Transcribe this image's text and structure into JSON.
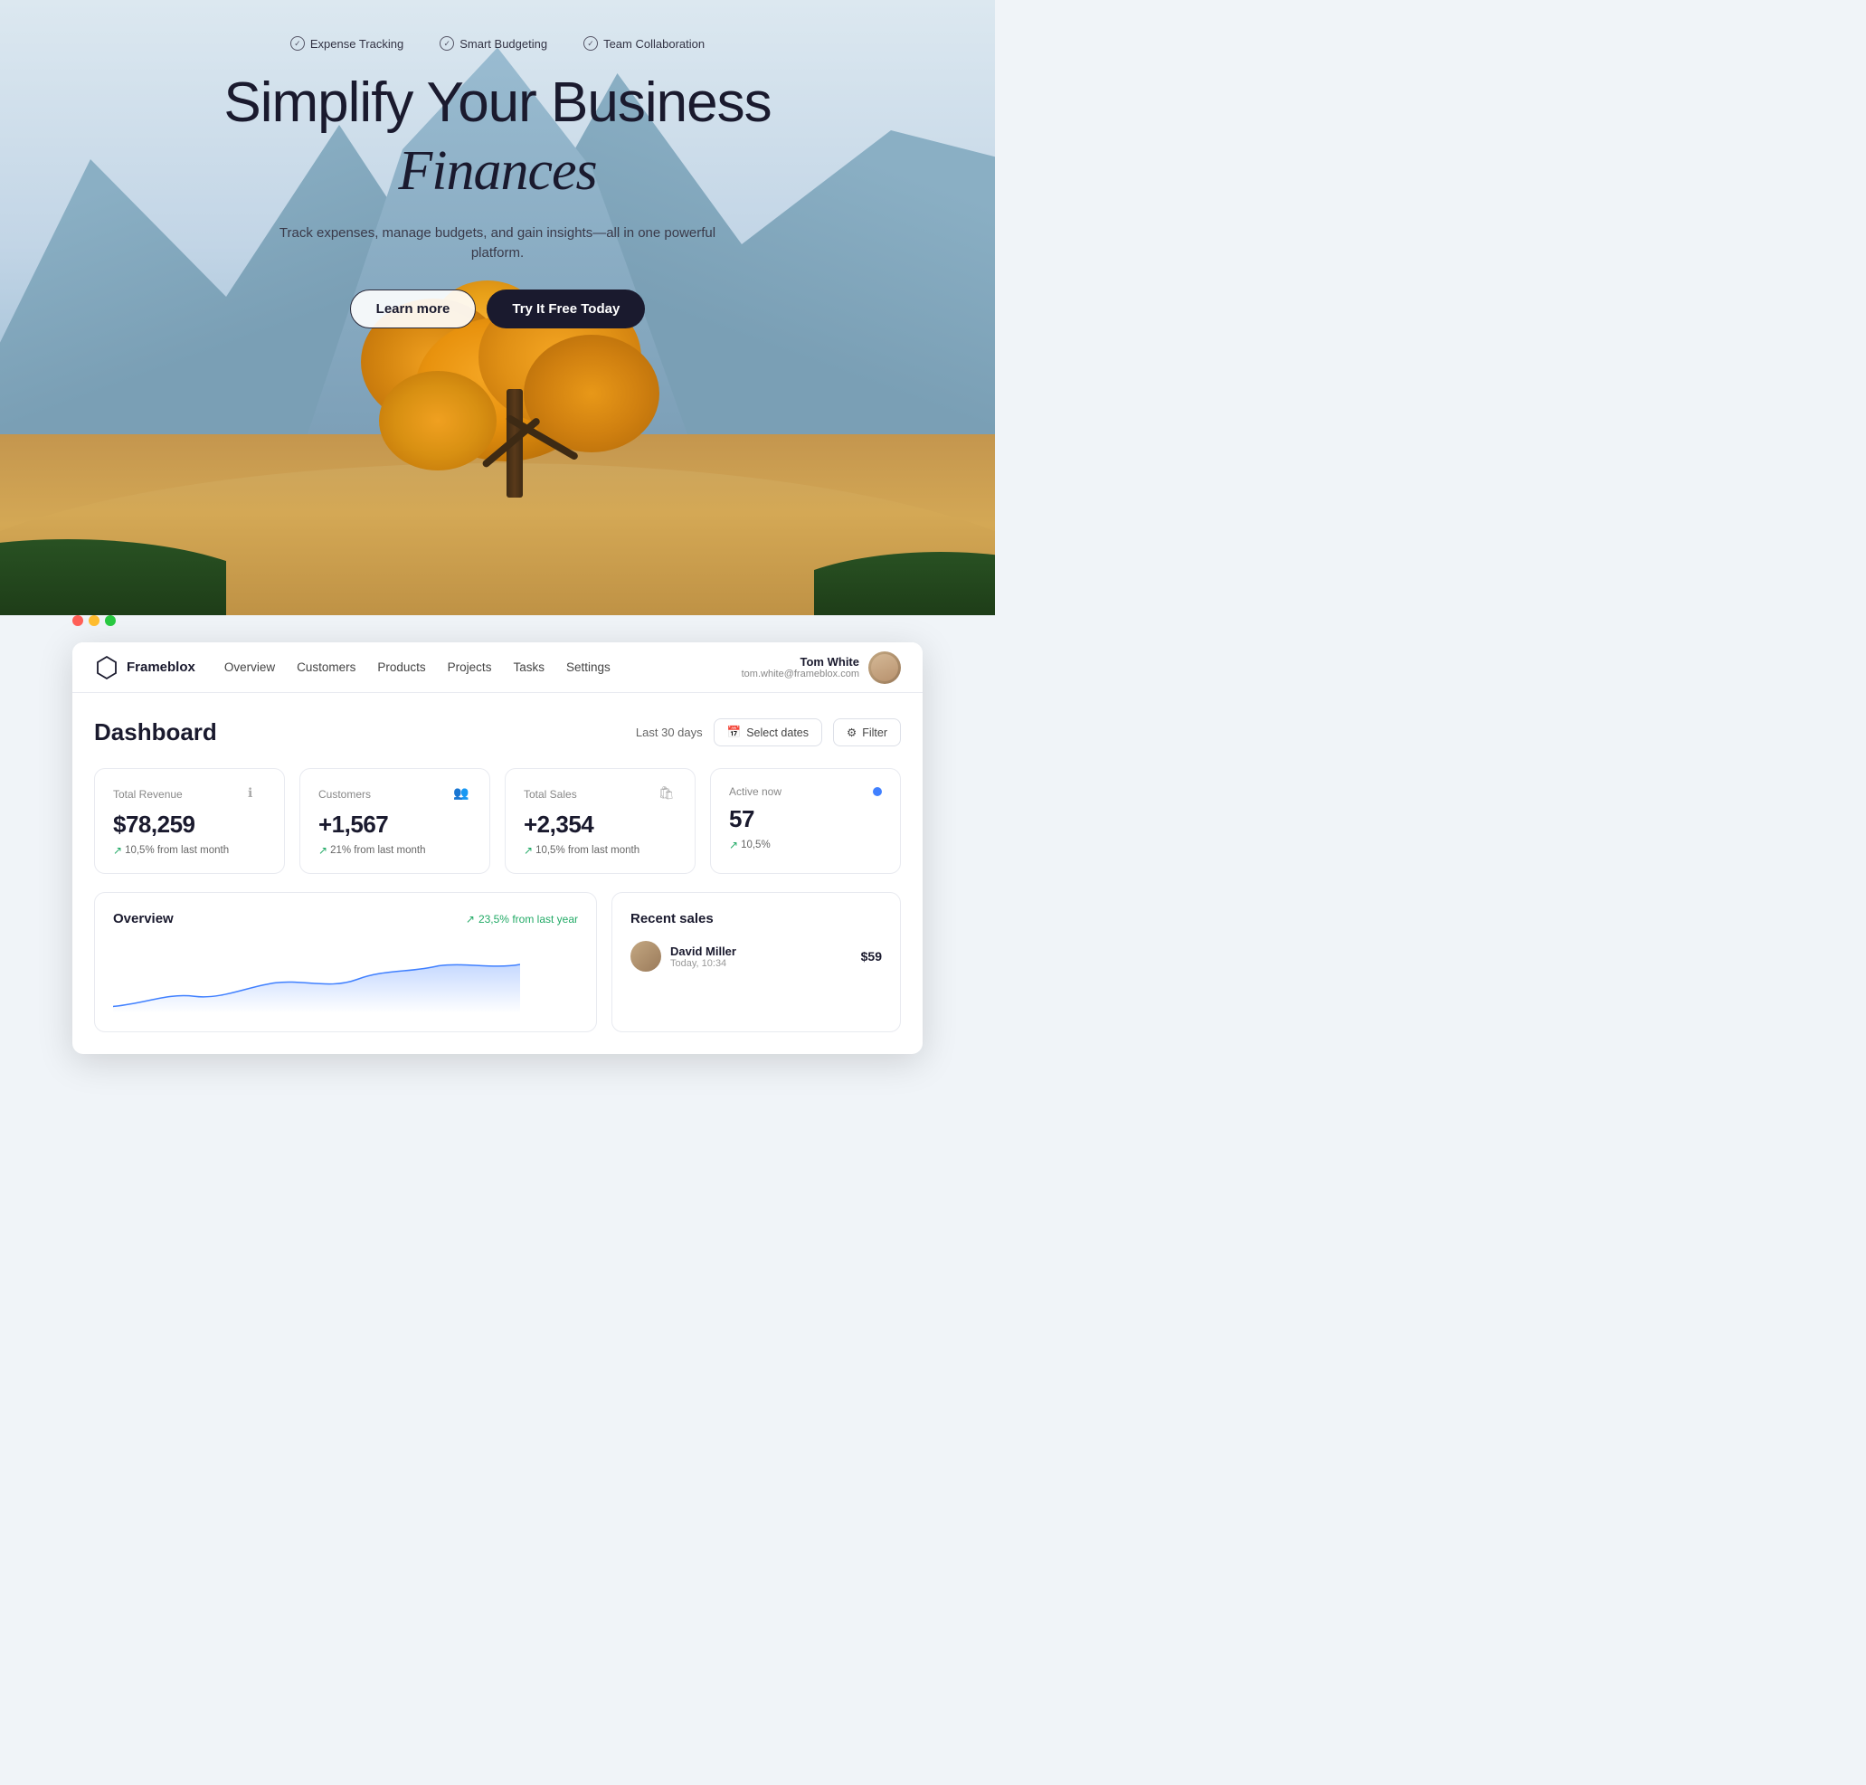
{
  "hero": {
    "features": [
      {
        "id": "expense-tracking",
        "label": "Expense Tracking"
      },
      {
        "id": "smart-budgeting",
        "label": "Smart Budgeting"
      },
      {
        "id": "team-collaboration",
        "label": "Team Collaboration"
      }
    ],
    "title_line1": "Simplify Your Business",
    "title_line2_italic": "Finances",
    "subtitle": "Track expenses, manage budgets, and gain insights—all in one powerful platform.",
    "btn_learn": "Learn more",
    "btn_try": "Try It Free Today"
  },
  "app": {
    "logo_text": "Frameblox",
    "nav_links": [
      {
        "id": "overview",
        "label": "Overview"
      },
      {
        "id": "customers",
        "label": "Customers"
      },
      {
        "id": "products",
        "label": "Products"
      },
      {
        "id": "projects",
        "label": "Projects"
      },
      {
        "id": "tasks",
        "label": "Tasks"
      },
      {
        "id": "settings",
        "label": "Settings"
      }
    ],
    "user_name": "Tom White",
    "user_email": "tom.white@frameblox.com"
  },
  "dashboard": {
    "title": "Dashboard",
    "period": "Last 30 days",
    "btn_dates": "Select dates",
    "btn_filter": "Filter",
    "stats": [
      {
        "id": "total-revenue",
        "label": "Total Revenue",
        "value": "$78,259",
        "trend": "10,5% from last month",
        "icon": "info-circle"
      },
      {
        "id": "customers",
        "label": "Customers",
        "value": "+1,567",
        "trend": "21% from last month",
        "icon": "users"
      },
      {
        "id": "total-sales",
        "label": "Total Sales",
        "value": "+2,354",
        "trend": "10,5% from last month",
        "icon": "bag"
      },
      {
        "id": "active-now",
        "label": "Active now",
        "value": "57",
        "trend": "10,5%",
        "icon": "dot"
      }
    ],
    "overview_title": "Overview",
    "overview_trend": "23,5% from last year",
    "recent_sales_title": "Recent sales",
    "recent_sales": [
      {
        "id": "david-miller",
        "name": "David Miller",
        "time": "Today, 10:34",
        "amount": "$59"
      }
    ]
  }
}
